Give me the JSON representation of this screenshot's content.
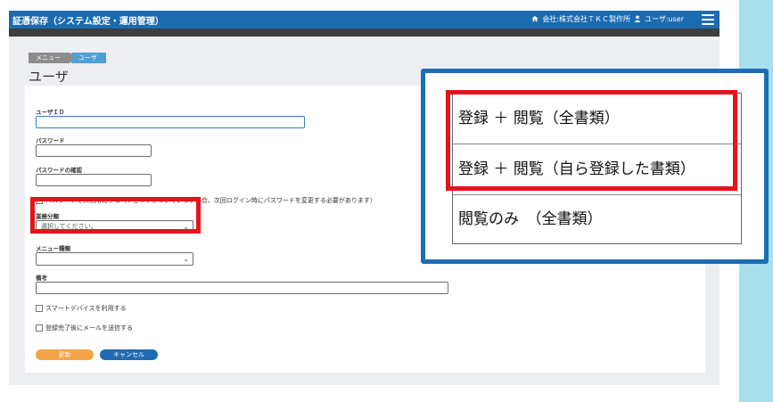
{
  "app": {
    "title": "証憑保存（システム設定・運用管理）",
    "company": "会社:株式会社ＴＫＣ製作所",
    "user": "ユーザ:user"
  },
  "breadcrumb": [
    "メニュー",
    "ユーザ"
  ],
  "page_title": "ユーザ",
  "form": {
    "user_id_label": "ユーザＩＤ",
    "password_label": "パスワード",
    "password_confirm_label": "パスワードの確認",
    "no_expiry_checkbox_label": "パスワードを無期限にする（チェックがついていない場合、次回ログイン時にパスワードを変更する必要があります）",
    "business_class_label": "業務分類",
    "business_class_placeholder": "選択してください。",
    "menu_type_label": "メニュー種類",
    "menu_type_value": "",
    "remarks_label": "備考",
    "smart_device_label": "スマートデバイスを利用する",
    "send_mail_label": "登録完了後にメールを送信する",
    "update_button": "更新",
    "cancel_button": "キャンセル"
  },
  "callout": {
    "options": [
      "登録 ＋ 閲覧（全書類）",
      "登録 ＋ 閲覧（自ら登録した書類）",
      "閲覧のみ　（全書類）"
    ]
  },
  "colors": {
    "header": "#1b6bb0",
    "highlight": "#e8121a",
    "callout_border": "#1c6cb6",
    "update_button": "#f5a245",
    "cancel_button": "#1e6ab4"
  }
}
